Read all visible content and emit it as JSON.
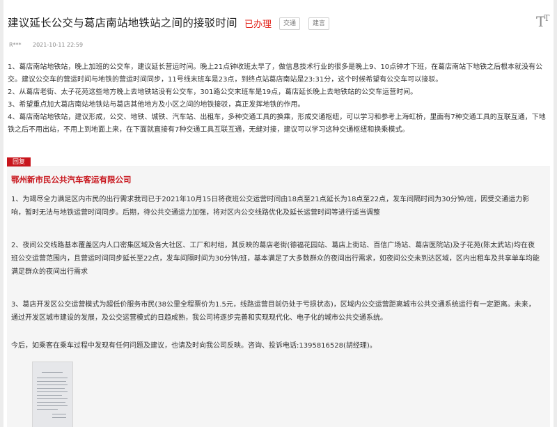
{
  "header": {
    "title": "建议延长公交与葛店南站地铁站之间的接驳时间",
    "status": "已办理",
    "tags": [
      "交通",
      "建言"
    ],
    "font_size_icon": "font-size-icon"
  },
  "meta": {
    "author": "R***",
    "time": "2021-10-11 22:59"
  },
  "question": {
    "paragraphs": [
      "1、葛店南站地铁站，晚上加班的公交车，建议延长营运时间。晚上21点钟收班太早了，做信息技术行业的很多是晚上9、10点钟才下班，在葛店南站下地铁之后根本就没有公交。建议公交车的营运时间与地铁的营运时间同步，11号线末班车是23点，到终点站葛店南站是23:31分，这个时候希望有公交车可以接驳。",
      "2、从葛店老街、太子花苑这些地方晚上去地铁站没有公交车，301路公交末班车是19点，葛店延长晚上去地铁站的公交车运营时间。",
      "3、希望重点加大葛店南站地铁站与葛店其他地方及小区之间的地铁接驳，真正发挥地铁的作用。",
      "4、葛店南站地铁站，建议形成，公交、地铁、城铁、汽车站、出租车，多种交通工具的换乘，形成交通枢纽，可以学习和参考上海虹桥，里面有7种交通工具的互联互通，下地铁之后不用出站，不用上到地面上来，在下面就直接有7种交通工具互联互通，无缝对接，建议可以学习这种交通枢纽和换乘模式。"
    ]
  },
  "reply": {
    "badge": "回复",
    "org": "鄂州新市民公共汽车客运有限公司",
    "paragraphs": [
      "1、为竭尽全力满足区内市民的出行需求我司已于2021年10月15日将夜班公交运营时间由18点至21点延长为18点至22点，发车间隔时间为30分钟/班，因受交通运力影响，暂时无法与地铁运营时间同步。后期，待公共交通运力加强，将对区内公交线路优化及延长运营时间等进行适当调整",
      "2、夜间公交线路基本覆盖区内人口密集区域及各大社区、工厂和村组，其反映的葛店老街(德福花园站、葛店上街站、百信广场站、葛店医院站)及子花苑(陈太武站)均在夜班公交运营范围内，且营运时间同步延长至22点，发车间隔时间为30分钟/班，基本满足了大多数群众的夜间出行需求，如夜间公交未到达区域，区内出租车及共享单车均能满足群众的夜间出行需求",
      "3、葛店开发区公交运营模式为超低价服务市民(38公里全程票价为1.5元，线路运营目前仍处于亏损状态)，区域内公交运营距离城市公共交通系统运行有一定距离。未来，通过开发区城市建设的发展，及公交运营模式的日趋成熟，我公司将逐步完善和实现现代化、电子化的城市公共交通系统。",
      "今后，如乘客在乘车过程中发现有任何问题及建议，也请及时向我公司反映。咨询、投诉电话:1395816528(胡经理)。"
    ]
  },
  "colors": {
    "accent": "#c8161d",
    "status": "#e2231a",
    "reply_bg": "#f5f5f5"
  }
}
